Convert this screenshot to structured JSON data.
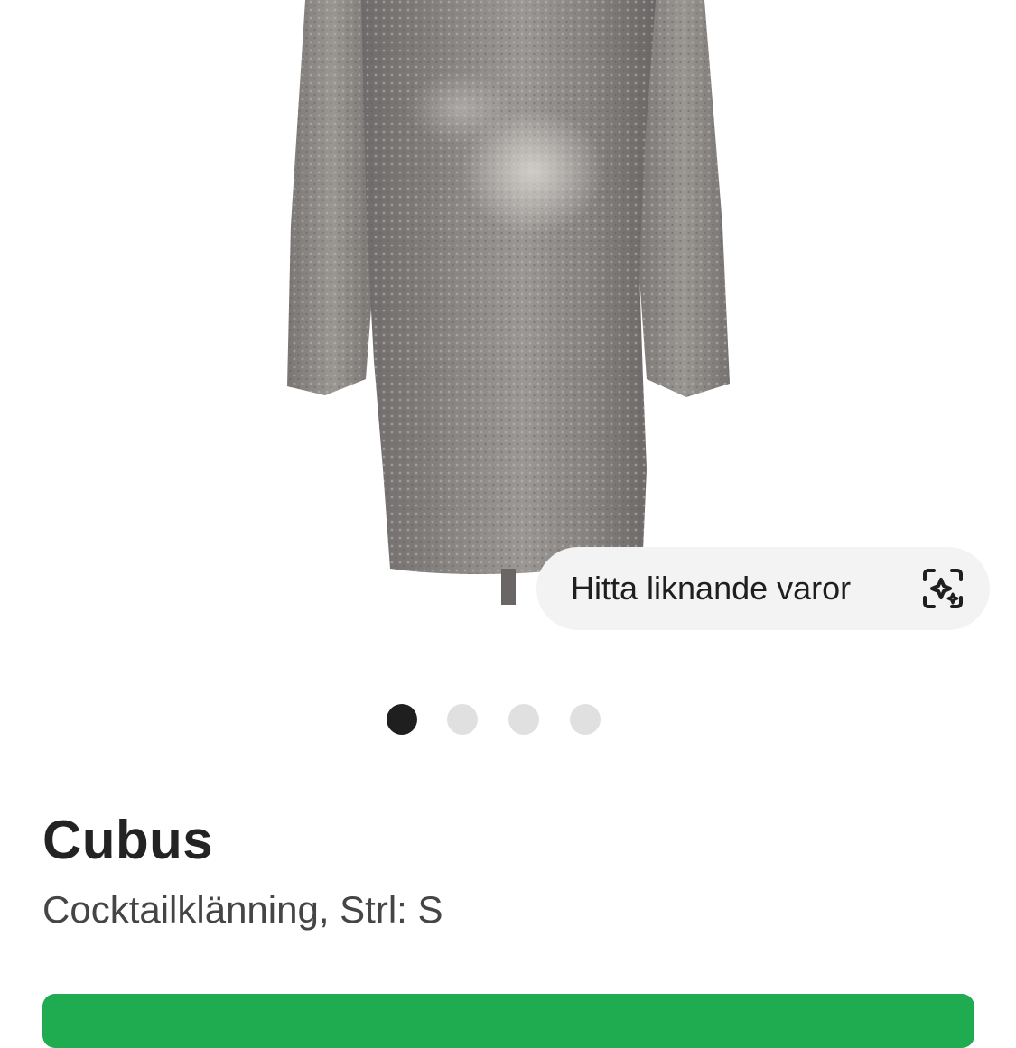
{
  "gallery": {
    "find_similar_label": "Hitta liknande varor",
    "find_similar_icon": "scan-sparkle-icon",
    "current_image": 1,
    "image_count": 4
  },
  "product": {
    "brand": "Cubus",
    "subtitle": "Cocktailklänning, Strl: S"
  },
  "colors": {
    "accent": "#1fab4f",
    "dot_active": "#1f1f1f",
    "dot_inactive": "#e0e0e0"
  }
}
